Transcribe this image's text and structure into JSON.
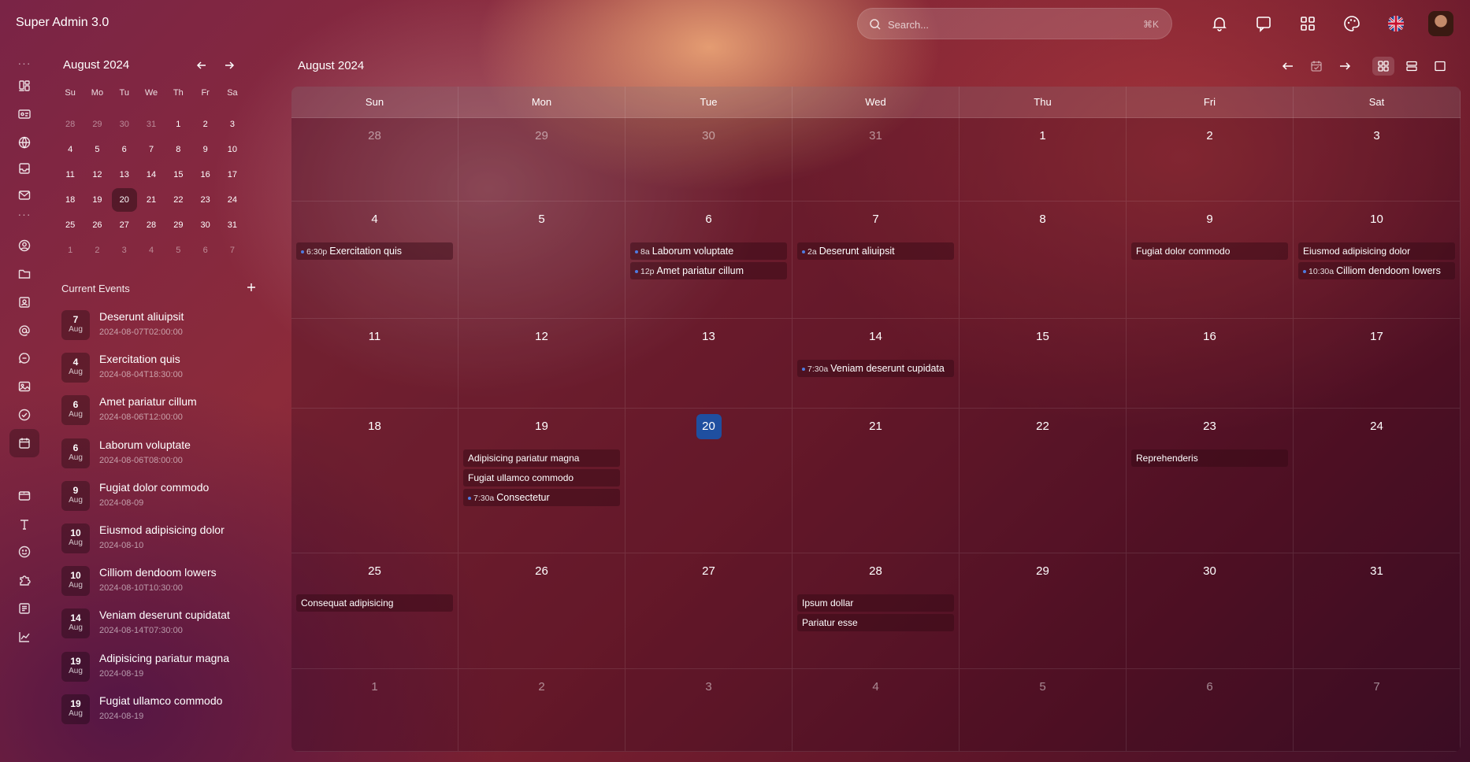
{
  "app": {
    "title": "Super Admin 3.0"
  },
  "search": {
    "placeholder": "Search...",
    "shortcut": "⌘K"
  },
  "topbar_icons": [
    "bell-icon",
    "chat-icon",
    "apps-grid-icon",
    "palette-icon",
    "uk-flag-icon",
    "avatar"
  ],
  "rail": {
    "items": [
      "dashboard-icon",
      "id-card-icon",
      "globe-icon",
      "inbox-icon",
      "mail-icon",
      "user-circle-icon",
      "folder-icon",
      "contact-icon",
      "at-sign-icon",
      "chat-bubble-icon",
      "image-icon",
      "check-circle-icon",
      "calendar-icon",
      "wallet-icon",
      "type-icon",
      "smile-icon",
      "puzzle-icon",
      "form-icon",
      "chart-line-icon"
    ],
    "active": "calendar-icon"
  },
  "mini_calendar": {
    "title": "August 2024",
    "weekdays": [
      "Su",
      "Mo",
      "Tu",
      "We",
      "Th",
      "Fr",
      "Sa"
    ],
    "days": [
      {
        "d": "28",
        "muted": true
      },
      {
        "d": "29",
        "muted": true
      },
      {
        "d": "30",
        "muted": true
      },
      {
        "d": "31",
        "muted": true
      },
      {
        "d": "1"
      },
      {
        "d": "2"
      },
      {
        "d": "3"
      },
      {
        "d": "4"
      },
      {
        "d": "5"
      },
      {
        "d": "6"
      },
      {
        "d": "7"
      },
      {
        "d": "8"
      },
      {
        "d": "9"
      },
      {
        "d": "10"
      },
      {
        "d": "11"
      },
      {
        "d": "12"
      },
      {
        "d": "13"
      },
      {
        "d": "14"
      },
      {
        "d": "15"
      },
      {
        "d": "16"
      },
      {
        "d": "17"
      },
      {
        "d": "18"
      },
      {
        "d": "19"
      },
      {
        "d": "20",
        "selected": true
      },
      {
        "d": "21"
      },
      {
        "d": "22"
      },
      {
        "d": "23"
      },
      {
        "d": "24"
      },
      {
        "d": "25"
      },
      {
        "d": "26"
      },
      {
        "d": "27"
      },
      {
        "d": "28"
      },
      {
        "d": "29"
      },
      {
        "d": "30"
      },
      {
        "d": "31"
      },
      {
        "d": "1",
        "muted": true
      },
      {
        "d": "2",
        "muted": true
      },
      {
        "d": "3",
        "muted": true
      },
      {
        "d": "4",
        "muted": true
      },
      {
        "d": "5",
        "muted": true
      },
      {
        "d": "6",
        "muted": true
      },
      {
        "d": "7",
        "muted": true
      }
    ]
  },
  "current_events": {
    "heading": "Current Events",
    "items": [
      {
        "day": "7",
        "month": "Aug",
        "title": "Deserunt aliuipsit",
        "time": "2024-08-07T02:00:00"
      },
      {
        "day": "4",
        "month": "Aug",
        "title": "Exercitation quis",
        "time": "2024-08-04T18:30:00"
      },
      {
        "day": "6",
        "month": "Aug",
        "title": "Amet pariatur cillum",
        "time": "2024-08-06T12:00:00"
      },
      {
        "day": "6",
        "month": "Aug",
        "title": "Laborum voluptate",
        "time": "2024-08-06T08:00:00"
      },
      {
        "day": "9",
        "month": "Aug",
        "title": "Fugiat dolor commodo",
        "time": "2024-08-09"
      },
      {
        "day": "10",
        "month": "Aug",
        "title": "Eiusmod adipisicing dolor",
        "time": "2024-08-10"
      },
      {
        "day": "10",
        "month": "Aug",
        "title": "Cilliom dendoom lowers",
        "time": "2024-08-10T10:30:00"
      },
      {
        "day": "14",
        "month": "Aug",
        "title": "Veniam deserunt cupidatat",
        "time": "2024-08-14T07:30:00"
      },
      {
        "day": "19",
        "month": "Aug",
        "title": "Adipisicing pariatur magna",
        "time": "2024-08-19"
      },
      {
        "day": "19",
        "month": "Aug",
        "title": "Fugiat ullamco commodo",
        "time": "2024-08-19"
      }
    ]
  },
  "main": {
    "title": "August 2024",
    "toolbar": [
      "arrow-left-icon",
      "calendar-check-icon",
      "arrow-right-icon",
      "month-view-icon",
      "week-view-icon",
      "day-view-icon"
    ],
    "weekdays": [
      "Sun",
      "Mon",
      "Tue",
      "Wed",
      "Thu",
      "Fri",
      "Sat"
    ],
    "weeks": [
      [
        {
          "d": "28",
          "muted": true,
          "events": []
        },
        {
          "d": "29",
          "muted": true,
          "events": []
        },
        {
          "d": "30",
          "muted": true,
          "events": []
        },
        {
          "d": "31",
          "muted": true,
          "events": []
        },
        {
          "d": "1",
          "events": []
        },
        {
          "d": "2",
          "events": []
        },
        {
          "d": "3",
          "events": []
        }
      ],
      [
        {
          "d": "4",
          "events": [
            {
              "time": "6:30p",
              "title": "Exercitation quis"
            }
          ]
        },
        {
          "d": "5",
          "events": []
        },
        {
          "d": "6",
          "events": [
            {
              "time": "8a",
              "title": "Laborum voluptate"
            },
            {
              "time": "12p",
              "title": "Amet pariatur cillum"
            }
          ]
        },
        {
          "d": "7",
          "events": [
            {
              "time": "2a",
              "title": "Deserunt aliuipsit"
            }
          ]
        },
        {
          "d": "8",
          "events": []
        },
        {
          "d": "9",
          "events": [
            {
              "title": "Fugiat dolor commodo"
            }
          ]
        },
        {
          "d": "10",
          "events": [
            {
              "title": "Eiusmod adipisicing dolor"
            },
            {
              "time": "10:30a",
              "title": "Cilliom dendoom lowers"
            }
          ]
        }
      ],
      [
        {
          "d": "11",
          "events": []
        },
        {
          "d": "12",
          "events": []
        },
        {
          "d": "13",
          "events": []
        },
        {
          "d": "14",
          "events": [
            {
              "time": "7:30a",
              "title": "Veniam deserunt cupidata"
            }
          ]
        },
        {
          "d": "15",
          "events": []
        },
        {
          "d": "16",
          "events": []
        },
        {
          "d": "17",
          "events": []
        }
      ],
      [
        {
          "d": "18",
          "events": []
        },
        {
          "d": "19",
          "events": [
            {
              "title": "Adipisicing pariatur magna"
            },
            {
              "title": "Fugiat ullamco commodo"
            },
            {
              "time": "7:30a",
              "title": "Consectetur"
            }
          ]
        },
        {
          "d": "20",
          "today": true,
          "events": []
        },
        {
          "d": "21",
          "events": []
        },
        {
          "d": "22",
          "events": []
        },
        {
          "d": "23",
          "events": [
            {
              "title": "Reprehenderis"
            }
          ]
        },
        {
          "d": "24",
          "events": []
        }
      ],
      [
        {
          "d": "25",
          "events": [
            {
              "title": "Consequat adipisicing"
            }
          ]
        },
        {
          "d": "26",
          "events": []
        },
        {
          "d": "27",
          "events": []
        },
        {
          "d": "28",
          "events": [
            {
              "title": "Ipsum dollar"
            },
            {
              "title": "Pariatur esse"
            }
          ]
        },
        {
          "d": "29",
          "events": []
        },
        {
          "d": "30",
          "events": []
        },
        {
          "d": "31",
          "events": []
        }
      ],
      [
        {
          "d": "1",
          "muted": true,
          "events": []
        },
        {
          "d": "2",
          "muted": true,
          "events": []
        },
        {
          "d": "3",
          "muted": true,
          "events": []
        },
        {
          "d": "4",
          "muted": true,
          "events": []
        },
        {
          "d": "5",
          "muted": true,
          "events": []
        },
        {
          "d": "6",
          "muted": true,
          "events": []
        },
        {
          "d": "7",
          "muted": true,
          "events": []
        }
      ]
    ]
  },
  "colors": {
    "today": "#1f4fa0",
    "event_dot": "#4f7be0"
  }
}
